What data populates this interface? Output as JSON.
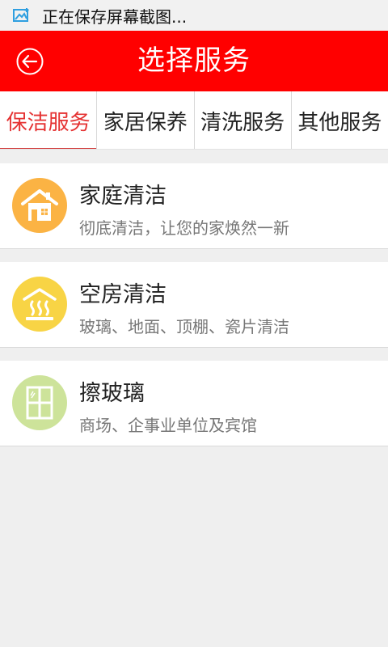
{
  "status_bar": {
    "text": "正在保存屏幕截图...",
    "icon": "screenshot-image-icon"
  },
  "header": {
    "title": "选择服务",
    "back_icon": "back-arrow-icon",
    "color": "#ff0000"
  },
  "tabs": [
    {
      "label": "保洁服务",
      "active": true
    },
    {
      "label": "家居保养",
      "active": false
    },
    {
      "label": "清洗服务",
      "active": false
    },
    {
      "label": "其他服务",
      "active": false
    }
  ],
  "services": [
    {
      "name": "家庭清洁",
      "desc": "彻底清洁，让您的家焕然一新",
      "icon": "house-icon",
      "icon_color": "#fbb344"
    },
    {
      "name": "空房清洁",
      "desc": "玻璃、地面、顶棚、瓷片清洁",
      "icon": "heater-icon",
      "icon_color": "#f8d445"
    },
    {
      "name": "擦玻璃",
      "desc": "商场、企事业单位及宾馆",
      "icon": "window-icon",
      "icon_color": "#cde39a"
    }
  ],
  "colors": {
    "accent": "#ff0000",
    "active_tab": "#e53333",
    "background": "#efefef"
  }
}
